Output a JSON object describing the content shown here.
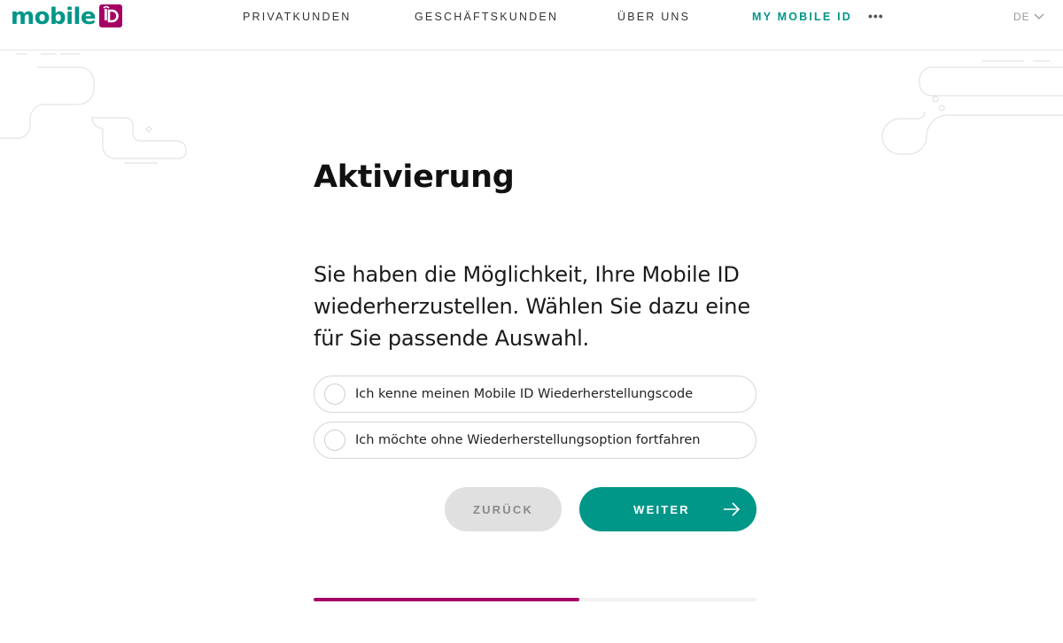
{
  "brand": {
    "name": "mobile",
    "badge_icon": "id-badge-icon",
    "primary_color": "#009688",
    "accent_color": "#a50064"
  },
  "nav": {
    "items": [
      {
        "label": "PRIVATKUNDEN"
      },
      {
        "label": "GESCHÄFTSKUNDEN"
      },
      {
        "label": "ÜBER UNS"
      },
      {
        "label": "MY MOBILE ID",
        "active": true
      }
    ],
    "more_label": "•••",
    "language": "DE"
  },
  "page": {
    "title": "Aktivierung",
    "intro": "Sie haben die Möglichkeit, Ihre Mobile ID wiederherzustellen. Wählen Sie dazu eine für Sie passende Auswahl."
  },
  "options": [
    {
      "label": "Ich kenne meinen Mobile ID Wiederherstellungscode",
      "selected": false
    },
    {
      "label": "Ich möchte ohne Wiederherstellungsoption fortfahren",
      "selected": false
    }
  ],
  "actions": {
    "back_label": "ZURÜCK",
    "next_label": "WEITER"
  },
  "progress": {
    "fraction": 0.6
  }
}
